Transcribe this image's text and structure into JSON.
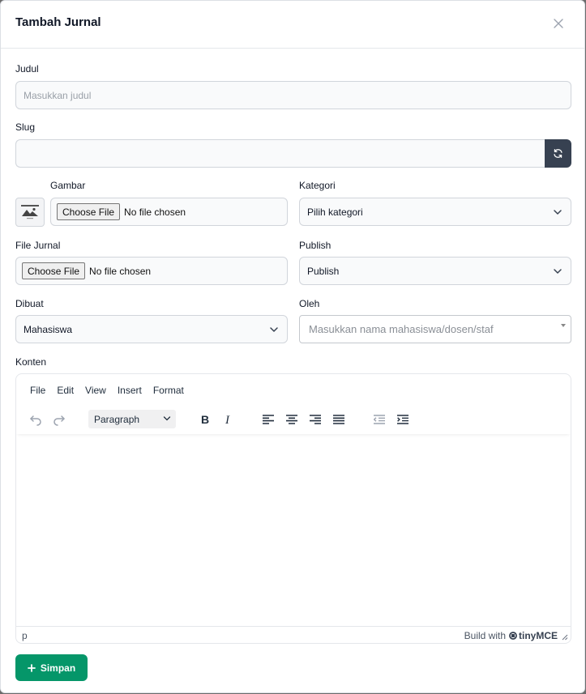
{
  "modal": {
    "title": "Tambah Jurnal"
  },
  "form": {
    "judul": {
      "label": "Judul",
      "placeholder": "Masukkan judul"
    },
    "slug": {
      "label": "Slug",
      "value": ""
    },
    "gambar": {
      "label": "Gambar",
      "button": "Choose File",
      "status": "No file chosen"
    },
    "kategori": {
      "label": "Kategori",
      "selected": "Pilih kategori"
    },
    "file_jurnal": {
      "label": "File Jurnal",
      "button": "Choose File",
      "status": "No file chosen"
    },
    "publish": {
      "label": "Publish",
      "selected": "Publish"
    },
    "dibuat": {
      "label": "Dibuat",
      "selected": "Mahasiswa"
    },
    "oleh": {
      "label": "Oleh",
      "placeholder": "Masukkan nama mahasiswa/dosen/staf"
    },
    "konten": {
      "label": "Konten"
    }
  },
  "editor": {
    "menu": [
      "File",
      "Edit",
      "View",
      "Insert",
      "Format"
    ],
    "block_format": "Paragraph",
    "status_path": "p",
    "brand_prefix": "Build with",
    "brand_name": "tinyMCE"
  },
  "actions": {
    "save_label": "Simpan"
  },
  "colors": {
    "primary": "#059669",
    "slug_button": "#374151"
  }
}
